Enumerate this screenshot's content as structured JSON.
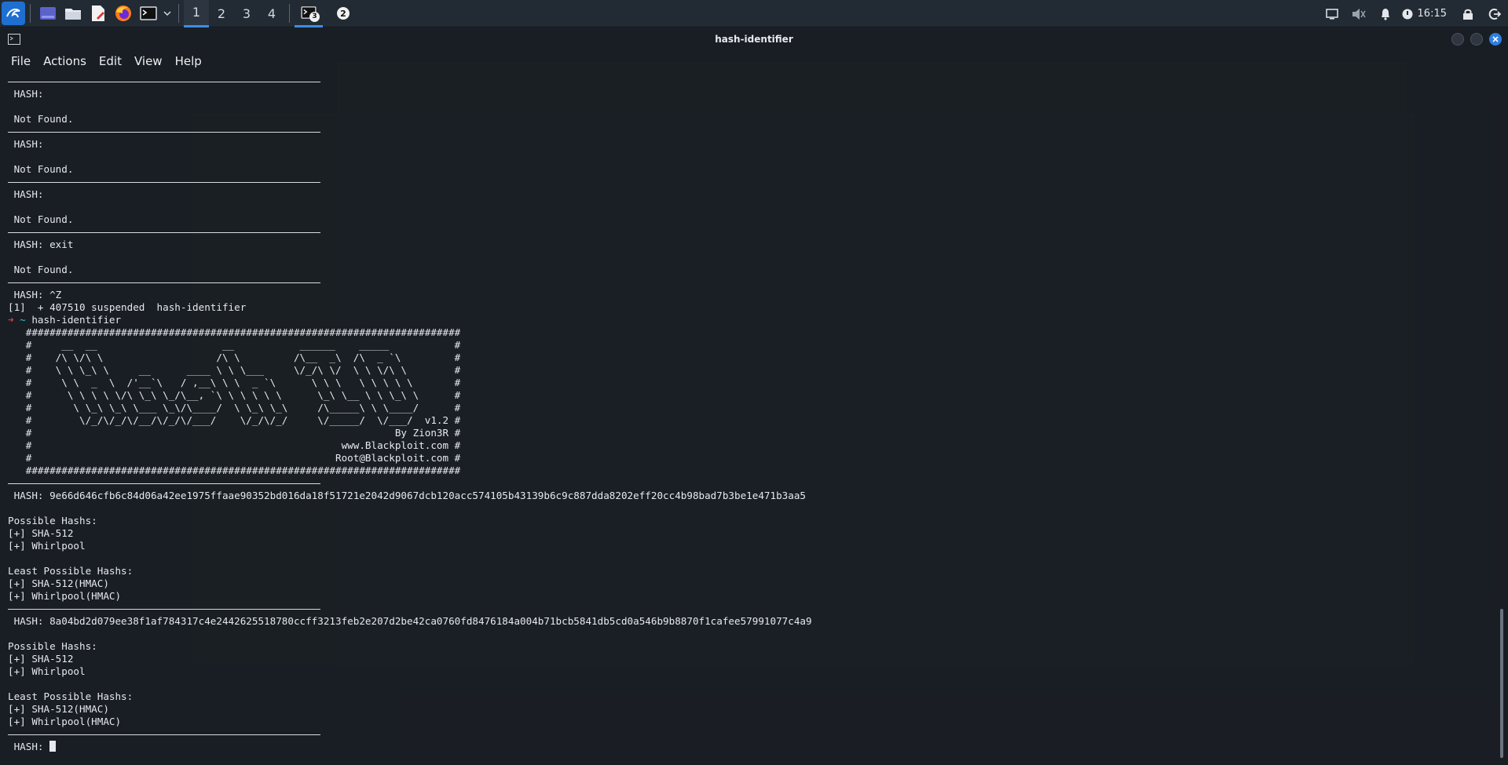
{
  "panel": {
    "workspaces": [
      "1",
      "2",
      "3",
      "4"
    ],
    "task_badge": "3",
    "window_count": "2",
    "clock": "16:15"
  },
  "window": {
    "title": "hash-identifier",
    "menus": [
      "File",
      "Actions",
      "Edit",
      "View",
      "Help"
    ]
  },
  "terminal": {
    "lines": [
      {
        "k": "rule"
      },
      {
        "k": "text",
        "t": " HASH:"
      },
      {
        "k": "text",
        "t": ""
      },
      {
        "k": "text",
        "t": " Not Found."
      },
      {
        "k": "rule"
      },
      {
        "k": "text",
        "t": " HASH:"
      },
      {
        "k": "text",
        "t": ""
      },
      {
        "k": "text",
        "t": " Not Found."
      },
      {
        "k": "rule"
      },
      {
        "k": "text",
        "t": " HASH:"
      },
      {
        "k": "text",
        "t": ""
      },
      {
        "k": "text",
        "t": " Not Found."
      },
      {
        "k": "rule"
      },
      {
        "k": "text",
        "t": " HASH: exit"
      },
      {
        "k": "text",
        "t": ""
      },
      {
        "k": "text",
        "t": " Not Found."
      },
      {
        "k": "rule"
      },
      {
        "k": "text",
        "t": " HASH: ^Z"
      },
      {
        "k": "text",
        "t": "[1]  + 407510 suspended  hash-identifier"
      },
      {
        "k": "prompt",
        "t": " hash-identifier"
      },
      {
        "k": "text",
        "t": "   #########################################################################"
      },
      {
        "k": "text",
        "t": "   #     __  __                     __           ______    _____           #"
      },
      {
        "k": "text",
        "t": "   #    /\\ \\/\\ \\                   /\\ \\         /\\__  _\\  /\\  _ `\\         #"
      },
      {
        "k": "text",
        "t": "   #    \\ \\ \\_\\ \\     __      ____ \\ \\ \\___     \\/_/\\ \\/  \\ \\ \\/\\ \\        #"
      },
      {
        "k": "text",
        "t": "   #     \\ \\  _  \\  /'__`\\   / ,__\\ \\ \\  _ `\\      \\ \\ \\   \\ \\ \\ \\ \\       #"
      },
      {
        "k": "text",
        "t": "   #      \\ \\ \\ \\ \\/\\ \\_\\ \\_/\\__, `\\ \\ \\ \\ \\ \\      \\_\\ \\__ \\ \\ \\_\\ \\      #"
      },
      {
        "k": "text",
        "t": "   #       \\ \\_\\ \\_\\ \\___ \\_\\/\\____/  \\ \\_\\ \\_\\     /\\_____\\ \\ \\____/      #"
      },
      {
        "k": "text",
        "t": "   #        \\/_/\\/_/\\/__/\\/_/\\/___/    \\/_/\\/_/     \\/_____/  \\/___/  v1.2 #"
      },
      {
        "k": "text",
        "t": "   #                                                             By Zion3R #"
      },
      {
        "k": "text",
        "t": "   #                                                    www.Blackploit.com #"
      },
      {
        "k": "text",
        "t": "   #                                                   Root@Blackploit.com #"
      },
      {
        "k": "text",
        "t": "   #########################################################################"
      },
      {
        "k": "rule"
      },
      {
        "k": "text",
        "t": " HASH: 9e66d646cfb6c84d06a42ee1975ffaae90352bd016da18f51721e2042d9067dcb120acc574105b43139b6c9c887dda8202eff20cc4b98bad7b3be1e471b3aa5"
      },
      {
        "k": "text",
        "t": ""
      },
      {
        "k": "text",
        "t": "Possible Hashs:"
      },
      {
        "k": "text",
        "t": "[+] SHA-512"
      },
      {
        "k": "text",
        "t": "[+] Whirlpool"
      },
      {
        "k": "text",
        "t": ""
      },
      {
        "k": "text",
        "t": "Least Possible Hashs:"
      },
      {
        "k": "text",
        "t": "[+] SHA-512(HMAC)"
      },
      {
        "k": "text",
        "t": "[+] Whirlpool(HMAC)"
      },
      {
        "k": "rule"
      },
      {
        "k": "text",
        "t": " HASH: 8a04bd2d079ee38f1af784317c4e2442625518780ccff3213feb2e207d2be42ca0760fd8476184a004b71bcb5841db5cd0a546b9b8870f1cafee57991077c4a9"
      },
      {
        "k": "text",
        "t": ""
      },
      {
        "k": "text",
        "t": "Possible Hashs:"
      },
      {
        "k": "text",
        "t": "[+] SHA-512"
      },
      {
        "k": "text",
        "t": "[+] Whirlpool"
      },
      {
        "k": "text",
        "t": ""
      },
      {
        "k": "text",
        "t": "Least Possible Hashs:"
      },
      {
        "k": "text",
        "t": "[+] SHA-512(HMAC)"
      },
      {
        "k": "text",
        "t": "[+] Whirlpool(HMAC)"
      },
      {
        "k": "rule"
      },
      {
        "k": "input",
        "t": " HASH: "
      }
    ]
  }
}
